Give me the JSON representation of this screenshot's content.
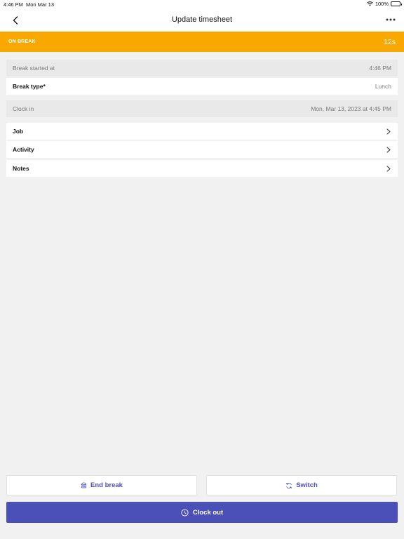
{
  "status_bar": {
    "time": "4:46 PM",
    "date": "Mon Mar 13",
    "battery": "100%"
  },
  "nav": {
    "title": "Update timesheet"
  },
  "banner": {
    "label": "ON BREAK",
    "timer": "12s",
    "color": "#f9a800"
  },
  "fields": [
    {
      "label": "Break started at",
      "value": "4:46 PM"
    },
    {
      "label": "Break type*",
      "value": "Lunch"
    },
    {
      "label": "Clock in",
      "value": "Mon, Mar 13, 2023 at 4:45 PM"
    },
    {
      "label": "Job"
    },
    {
      "label": "Activity"
    },
    {
      "label": "Notes"
    }
  ],
  "actions": {
    "end_break": "End break",
    "switch": "Switch",
    "clock_out": "Clock out"
  },
  "colors": {
    "accent": "#4b50b8",
    "background": "#f1f1f1"
  }
}
